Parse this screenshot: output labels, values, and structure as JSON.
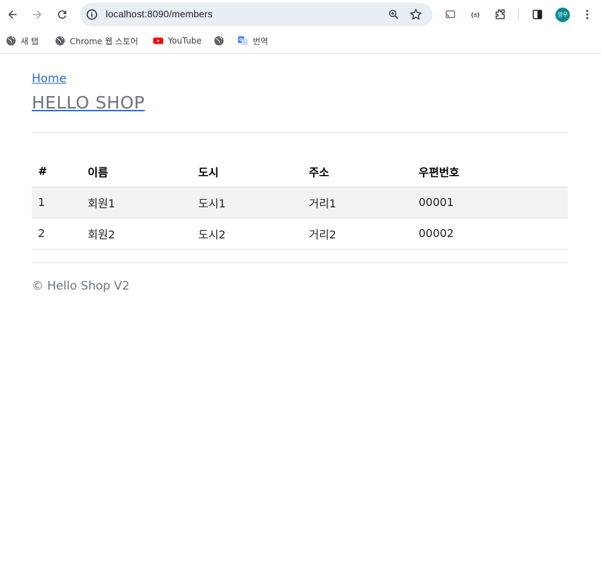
{
  "browser": {
    "url": "localhost:8090/members",
    "avatar_text": "영우",
    "bookmarks": [
      {
        "label": "새 탭",
        "icon": "globe-icon"
      },
      {
        "label": "Chrome 웹 스토어",
        "icon": "globe-icon"
      },
      {
        "label": "YouTube",
        "icon": "youtube-icon"
      },
      {
        "label": "",
        "icon": "globe-icon"
      },
      {
        "label": "번역",
        "icon": "translate-icon"
      }
    ]
  },
  "header": {
    "home_link": "Home",
    "brand": "HELLO SHOP"
  },
  "table": {
    "headers": [
      "#",
      "이름",
      "도시",
      "주소",
      "우편번호"
    ],
    "rows": [
      [
        "1",
        "회원1",
        "도시1",
        "거리1",
        "00001"
      ],
      [
        "2",
        "회원2",
        "도시2",
        "거리2",
        "00002"
      ]
    ]
  },
  "footer": {
    "text": "© Hello Shop V2"
  },
  "colors": {
    "link": "#2a6ad6",
    "muted": "#6c757d",
    "striped_row": "#f2f2f2",
    "omnibox_bg": "#e9edf4"
  }
}
